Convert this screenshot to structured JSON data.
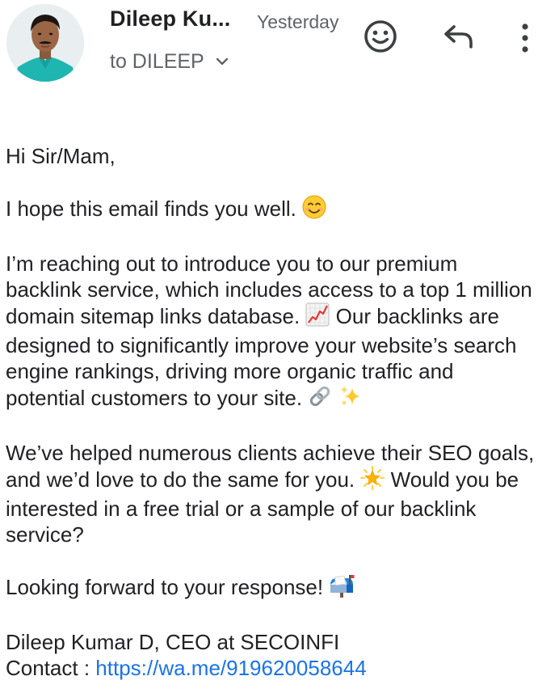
{
  "header": {
    "sender_name": "Dileep Ku...",
    "timestamp": "Yesterday",
    "recipient": "to DILEEP",
    "icons": {
      "avatar": "sender-avatar",
      "reaction": "smiley-face-icon",
      "reply": "reply-arrow-icon",
      "more": "more-vertical-icon",
      "expand": "chevron-down-icon"
    }
  },
  "email": {
    "greeting": "Hi Sir/Mam,",
    "para1": "I hope this email finds you well.",
    "para2": "I’m reaching out to introduce you to our premium backlink service, which includes access to a top 1 million domain sitemap links database.",
    "para2b": "Our backlinks are designed to significantly improve your website’s search engine rankings, driving more organic traffic and potential customers to your site.",
    "para3": "We’ve helped numerous clients achieve their SEO goals, and we’d love to do the same for you.",
    "para3b": "Would you be interested in a free trial or a sample of our backlink service?",
    "para4": "Looking forward to your response!",
    "signature": "Dileep Kumar D, CEO at SECOINFI",
    "contact_label": "Contact :",
    "contact_link": "https://wa.me/919620058644"
  },
  "colors": {
    "text": "#202124",
    "secondary": "#5f6368",
    "link": "#1a73e8"
  }
}
